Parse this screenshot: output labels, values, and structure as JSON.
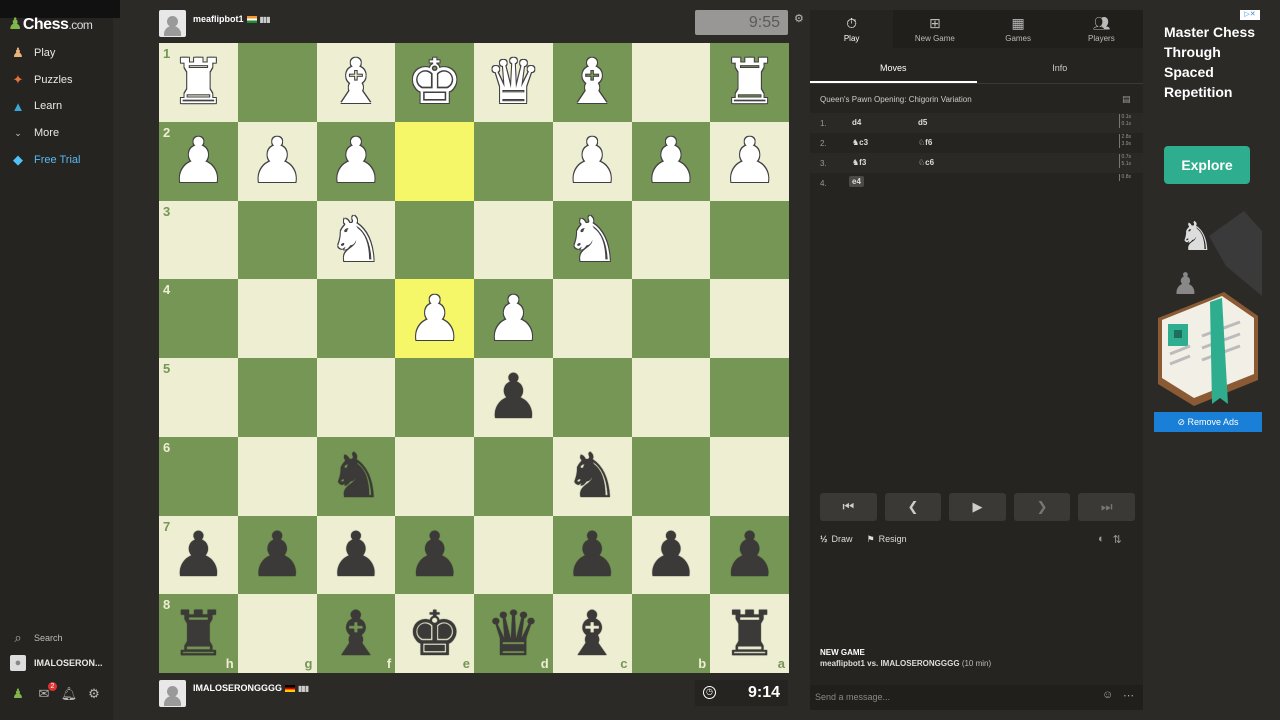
{
  "sidebar": {
    "logo": "Chess",
    "logo_suffix": ".com",
    "nav": [
      {
        "label": "Play",
        "icon": "play-icon"
      },
      {
        "label": "Puzzles",
        "icon": "puzzle-icon"
      },
      {
        "label": "Learn",
        "icon": "learn-icon"
      },
      {
        "label": "More",
        "icon": "chevron-down-icon"
      },
      {
        "label": "Free Trial",
        "icon": "diamond-icon"
      }
    ],
    "search_label": "Search",
    "username": "IMALOSERON...",
    "notif_count": "2"
  },
  "top_player": {
    "name": "meaflipbot1",
    "clock": "9:55"
  },
  "bottom_player": {
    "name": "IMALOSERONGGGG",
    "clock": "9:14"
  },
  "board": {
    "orientation": "black",
    "rank_labels": [
      "1",
      "2",
      "3",
      "4",
      "5",
      "6",
      "7",
      "8"
    ],
    "file_labels": [
      "h",
      "g",
      "f",
      "e",
      "d",
      "c",
      "b",
      "a"
    ],
    "highlighted": [
      "e2",
      "e4"
    ],
    "rows": [
      [
        "wR",
        "",
        "wB",
        "wK",
        "wQ",
        "wB",
        "",
        "wR"
      ],
      [
        "wP",
        "wP",
        "wP",
        "",
        "",
        "wP",
        "wP",
        "wP"
      ],
      [
        "",
        "",
        "wN",
        "",
        "",
        "wN",
        "",
        ""
      ],
      [
        "",
        "",
        "",
        "wP",
        "wP",
        "",
        "",
        ""
      ],
      [
        "",
        "",
        "",
        "",
        "bP",
        "",
        "",
        ""
      ],
      [
        "",
        "",
        "bN",
        "",
        "",
        "bN",
        "",
        ""
      ],
      [
        "bP",
        "bP",
        "bP",
        "bP",
        "",
        "bP",
        "bP",
        "bP"
      ],
      [
        "bR",
        "",
        "bB",
        "bK",
        "bQ",
        "bB",
        "",
        "bR"
      ]
    ]
  },
  "panel": {
    "tabs": [
      {
        "label": "Play",
        "icon": "stopwatch-icon"
      },
      {
        "label": "New Game",
        "icon": "plus-icon"
      },
      {
        "label": "Games",
        "icon": "board-icon"
      },
      {
        "label": "Players",
        "icon": "players-icon"
      }
    ],
    "subtabs": [
      "Moves",
      "Info"
    ],
    "opening": "Queen's Pawn Opening: Chigorin Variation",
    "moves": [
      {
        "num": "1.",
        "white": "d4",
        "black": "d5",
        "times": [
          "0.1s",
          "0.1s"
        ]
      },
      {
        "num": "2.",
        "white": "♞c3",
        "black": "♘f6",
        "times": [
          "2.8s",
          "3.9s"
        ]
      },
      {
        "num": "3.",
        "white": "♞f3",
        "black": "♘c6",
        "times": [
          "0.7s",
          "5.1s"
        ]
      },
      {
        "num": "4.",
        "white": "e4",
        "black": "",
        "times": [
          "0.8s"
        ]
      }
    ],
    "draw_label": "Draw",
    "draw_icon": "½",
    "resign_label": "Resign",
    "game_title": "NEW GAME",
    "game_players": "meaflipbot1 vs. IMALOSERONGGGG",
    "game_time": "(10 min)",
    "chat_placeholder": "Send a message..."
  },
  "ad": {
    "badge": "▷✕",
    "title": "Master Chess Through Spaced Repetition",
    "button": "Explore",
    "remove": "Remove Ads"
  }
}
